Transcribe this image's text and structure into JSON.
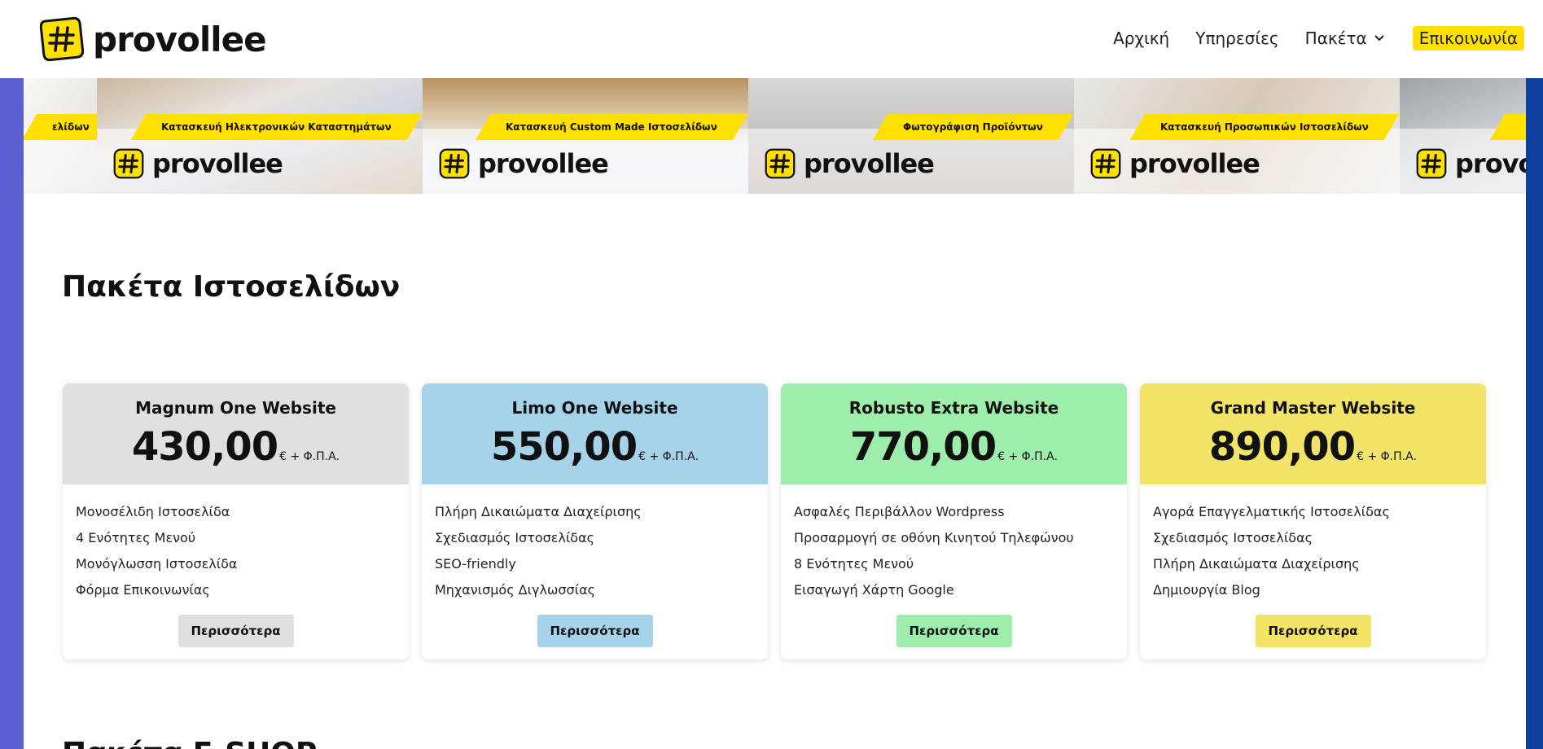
{
  "header": {
    "logo_text": "provollee",
    "nav": [
      {
        "label": "Αρχική"
      },
      {
        "label": "Υπηρεσίες"
      },
      {
        "label": "Πακέτα"
      },
      {
        "label": "Επικοινωνία"
      }
    ]
  },
  "banner": {
    "logo_text": "provollee",
    "tiles": [
      {
        "caption": "ελίδων"
      },
      {
        "caption": "Κατασκευή Ηλεκτρονικών Καταστημάτων"
      },
      {
        "caption": "Κατασκευή Custom Made Ιστοσελίδων"
      },
      {
        "caption": "Φωτογράφιση Προϊόντων"
      },
      {
        "caption": "Κατασκευή Προσωπικών Ιστοσελίδων"
      },
      {
        "caption": ""
      }
    ]
  },
  "section": {
    "title": "Πακέτα Ιστοσελίδων",
    "next_title": "Πακέτα E-SHOP"
  },
  "packages": [
    {
      "name": "Magnum One Website",
      "price": "430,00",
      "price_suffix": "€ + Φ.Π.Α.",
      "color": "#e0e0e0",
      "features": [
        "Μονοσέλιδη Ιστοσελίδα",
        "4 Ενότητες Μενού",
        "Μονόγλωσση Ιστοσελίδα",
        "Φόρμα Επικοινωνίας"
      ],
      "button": "Περισσότερα"
    },
    {
      "name": "Limo One Website",
      "price": "550,00",
      "price_suffix": "€ + Φ.Π.Α.",
      "color": "#a6d3ea",
      "features": [
        "Πλήρη Δικαιώματα Διαχείρισης",
        "Σχεδιασμός Ιστοσελίδας",
        "SEO-friendly",
        "Μηχανισμός Διγλωσσίας"
      ],
      "button": "Περισσότερα"
    },
    {
      "name": "Robusto Extra Website",
      "price": "770,00",
      "price_suffix": "€ + Φ.Π.Α.",
      "color": "#9dedab",
      "features": [
        "Ασφαλές Περιβάλλον Wordpress",
        "Προσαρμογή σε οθόνη Κινητού Τηλεφώνου",
        "8 Ενότητες Μενού",
        "Εισαγωγή Χάρτη Google"
      ],
      "button": "Περισσότερα"
    },
    {
      "name": "Grand Master Website",
      "price": "890,00",
      "price_suffix": "€ + Φ.Π.Α.",
      "color": "#f1e466",
      "features": [
        "Αγορά Επαγγελματικής Ιστοσελίδας",
        "Σχεδιασμός Ιστοσελίδας",
        "Πλήρη Δικαιώματα Διαχείρισης",
        "Δημιουργία Blog"
      ],
      "button": "Περισσότερα"
    }
  ],
  "colors": {
    "accent": "#ffe000",
    "left_bar": "#5b5fcf",
    "right_bar": "#0f3f9c"
  }
}
